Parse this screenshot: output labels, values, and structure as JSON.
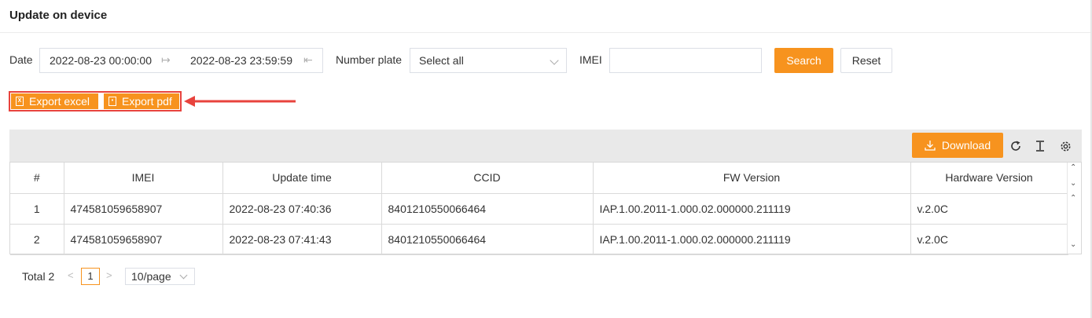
{
  "page": {
    "title": "Update on device"
  },
  "filters": {
    "date_label": "Date",
    "date_start": "2022-08-23 00:00:00",
    "date_end": "2022-08-23 23:59:59",
    "plate_label": "Number plate",
    "plate_value": "Select all",
    "imei_label": "IMEI",
    "imei_value": "",
    "search_label": "Search",
    "reset_label": "Reset"
  },
  "export": {
    "excel_label": "Export excel",
    "pdf_label": "Export pdf",
    "highlight_color": "#e8433d"
  },
  "toolbar": {
    "download_label": "Download",
    "icons": [
      "refresh-icon",
      "column-height-icon",
      "settings-icon"
    ]
  },
  "table": {
    "columns": [
      "#",
      "IMEI",
      "Update time",
      "CCID",
      "FW Version",
      "Hardware Version"
    ],
    "rows": [
      [
        "1",
        "474581059658907",
        "2022-08-23 07:40:36",
        "8401210550066464",
        "IAP.1.00.2011-1.000.02.000000.211119",
        "v.2.0C"
      ],
      [
        "2",
        "474581059658907",
        "2022-08-23 07:41:43",
        "8401210550066464",
        "IAP.1.00.2011-1.000.02.000000.211119",
        "v.2.0C"
      ]
    ]
  },
  "pagination": {
    "total_label": "Total 2",
    "current_page": "1",
    "page_size": "10/page"
  },
  "colors": {
    "accent": "#f7931e",
    "toolbar_bg": "#e9e9e9"
  }
}
